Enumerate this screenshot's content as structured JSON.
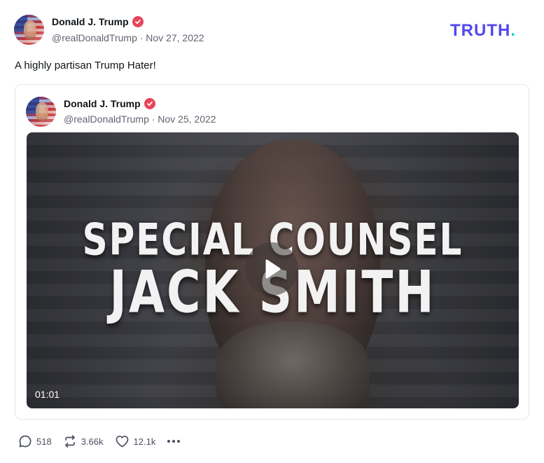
{
  "brand": {
    "logo_text": "TRUTH",
    "logo_dot": ".",
    "primary_color": "#5448ee",
    "accent_color": "#11d6c7"
  },
  "post": {
    "author_name": "Donald J. Trump",
    "handle_date": "@realDonaldTrump · Nov 27, 2022",
    "text": "A highly partisan Trump Hater!",
    "avatar_icon": "profile-avatar",
    "verified_icon": "verified-badge-icon",
    "verified_color": "#e8455a"
  },
  "quoted_post": {
    "author_name": "Donald J. Trump",
    "handle_date": "@realDonaldTrump · Nov 25, 2022",
    "video": {
      "title_line1": "SPECIAL COUNSEL",
      "title_line2": "JACK SMITH",
      "duration": "01:01",
      "play_icon": "play-icon"
    }
  },
  "actions": {
    "replies": "518",
    "retruths": "3.66k",
    "likes": "12.1k",
    "reply_icon": "comment-icon",
    "retruth_icon": "repost-icon",
    "like_icon": "heart-icon",
    "more_icon": "more-horizontal-icon"
  }
}
